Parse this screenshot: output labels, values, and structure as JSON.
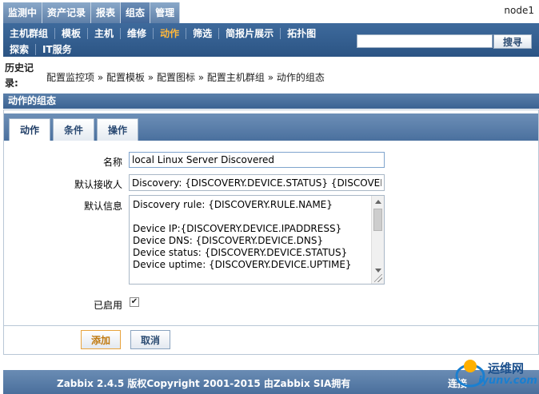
{
  "top_menu": {
    "items": [
      "监测中",
      "资产记录",
      "报表",
      "组态",
      "管理"
    ],
    "active_index": 3,
    "node": "node1"
  },
  "sub_menu": {
    "row1": [
      "主机群组",
      "模板",
      "主机",
      "维修",
      "动作",
      "筛选",
      "简报片展示",
      "拓扑图"
    ],
    "row2": [
      "探索",
      "IT服务"
    ],
    "active": "动作",
    "search_value": "",
    "search_label": "搜寻"
  },
  "history": {
    "label": "历史记录:",
    "path": "配置监控项 » 配置模板 » 配置图标 » 配置主机群组 » 动作的组态"
  },
  "section": {
    "title": "动作的组态"
  },
  "tabs": [
    "动作",
    "条件",
    "操作"
  ],
  "form": {
    "name_label": "名称",
    "name_value": "local Linux Server Discovered",
    "recipient_label": "默认接收人",
    "recipient_value": "Discovery: {DISCOVERY.DEVICE.STATUS} {DISCOVERY.DEVICE.IPADDRESS}",
    "message_label": "默认信息",
    "message_value": "Discovery rule: {DISCOVERY.RULE.NAME}\n\nDevice IP:{DISCOVERY.DEVICE.IPADDRESS}\nDevice DNS: {DISCOVERY.DEVICE.DNS}\nDevice status: {DISCOVERY.DEVICE.STATUS}\nDevice uptime: {DISCOVERY.DEVICE.UPTIME}",
    "enabled_label": "已启用",
    "enabled_mark": "✔"
  },
  "buttons": {
    "add": "添加",
    "cancel": "取消"
  },
  "footer": {
    "text": "Zabbix 2.4.5 版权Copyright 2001-2015 由Zabbix SIA拥有",
    "right": "连接"
  },
  "watermark": {
    "cn": "运维网",
    "en": "iyunv.com"
  }
}
